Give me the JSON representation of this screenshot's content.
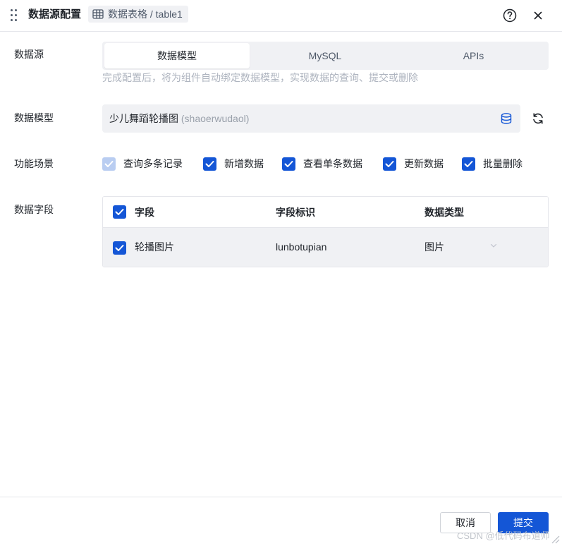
{
  "header": {
    "title": "数据源配置",
    "breadcrumb": "数据表格 / table1"
  },
  "form": {
    "datasource_label": "数据源",
    "datasource_tabs": [
      {
        "label": "数据模型",
        "active": true
      },
      {
        "label": "MySQL",
        "active": false
      },
      {
        "label": "APIs",
        "active": false
      }
    ],
    "hint": "完成配置后，将为组件自动绑定数据模型，实现数据的查询、提交或删除",
    "model_label": "数据模型",
    "model_value": "少儿舞蹈轮播图",
    "model_id": "(shaoerwudaol)",
    "scene_label": "功能场景",
    "scenes": [
      {
        "label": "查询多条记录",
        "checked": true,
        "disabled": true
      },
      {
        "label": "新增数据",
        "checked": true,
        "disabled": false
      },
      {
        "label": "查看单条数据",
        "checked": true,
        "disabled": false
      },
      {
        "label": "更新数据",
        "checked": true,
        "disabled": false
      },
      {
        "label": "批量删除",
        "checked": true,
        "disabled": false
      }
    ],
    "fields_label": "数据字段",
    "fields_table": {
      "headers": [
        "字段",
        "字段标识",
        "数据类型"
      ],
      "rows": [
        {
          "name": "轮播图片",
          "id": "lunbotupian",
          "type": "图片",
          "checked": true
        }
      ]
    }
  },
  "footer": {
    "cancel_label": "取消",
    "submit_label": "提交"
  },
  "watermark": "CSDN @低代码布道师",
  "colors": {
    "accent": "#1456d6",
    "disabled_check": "#b9cdf1",
    "muted_bg": "#f0f1f4",
    "hint_text": "#aeb4bf"
  },
  "icons": {
    "drag": "drag-handle-icon",
    "breadcrumb": "table-icon",
    "help": "help-circle-icon",
    "close": "close-icon",
    "database": "database-icon",
    "refresh": "refresh-icon",
    "check": "check-icon",
    "dropdown": "chevron-down-icon"
  }
}
